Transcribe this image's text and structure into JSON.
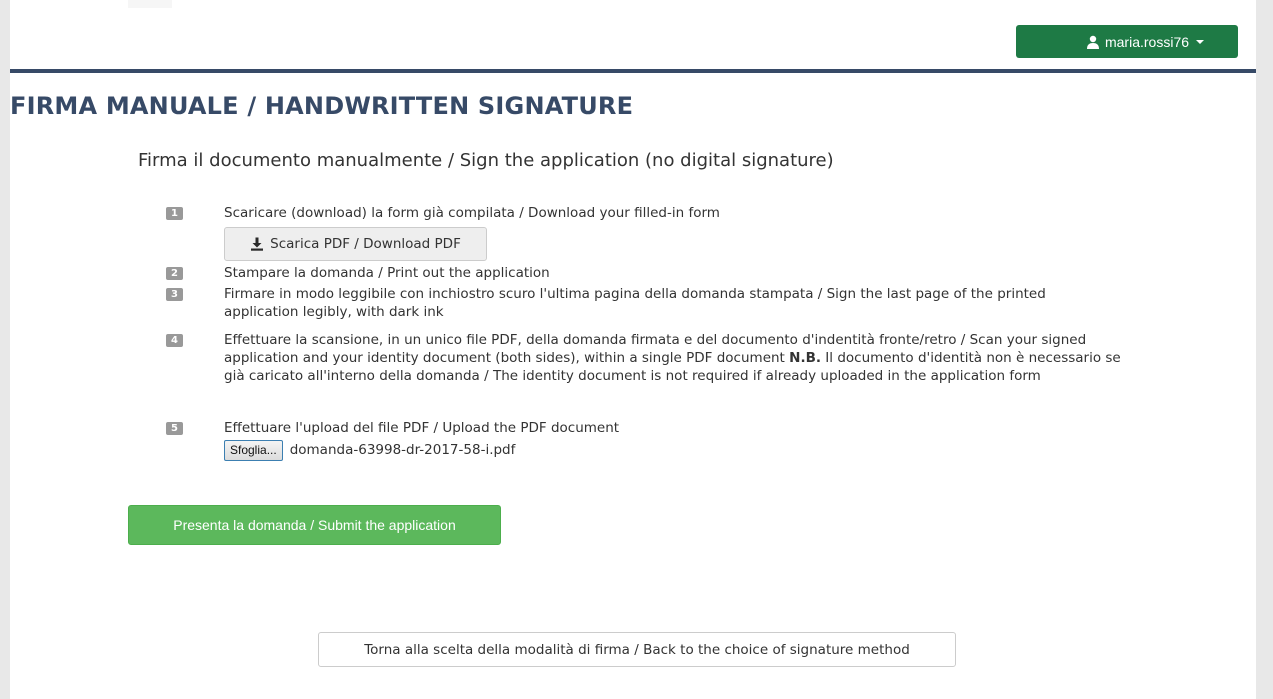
{
  "header": {
    "username": "maria.rossi76",
    "user_icon": "user-icon"
  },
  "page": {
    "title": "FIRMA MANUALE / HANDWRITTEN SIGNATURE",
    "subtitle": "Firma il documento manualmente / Sign the application (no digital signature)"
  },
  "steps": [
    {
      "num": "1",
      "text": "Scaricare (download) la form già compilata / Download your filled-in form"
    },
    {
      "num": "2",
      "text": "Stampare la domanda / Print out the application"
    },
    {
      "num": "3",
      "text": "Firmare in modo leggibile con inchiostro scuro l'ultima pagina della domanda stampata / Sign the last page of the printed application legibly, with dark ink"
    },
    {
      "num": "4",
      "text_before": "Effettuare la scansione, in un unico file PDF, della domanda firmata e del documento d'indentità fronte/retro / Scan your signed application and your identity document (both sides), within a single PDF document ",
      "note_label": "N.B.",
      "text_after": " Il documento d'identità non è necessario se già caricato all'interno della domanda / The identity document is not required if already uploaded in the application form"
    },
    {
      "num": "5",
      "text": "Effettuare l'upload del file PDF / Upload the PDF document"
    }
  ],
  "download": {
    "label": "Scarica PDF / Download PDF",
    "icon": "download-icon"
  },
  "upload": {
    "browse_label": "Sfoglia...",
    "file_name": "domanda-63998-dr-2017-58-i.pdf"
  },
  "actions": {
    "submit_label": "Presenta la domanda / Submit the application",
    "back_label": "Torna alla scelta della modalità di firma / Back to the choice of signature method"
  },
  "colors": {
    "header_button": "#1e7a45",
    "title": "#374a67",
    "submit": "#5cb85c",
    "badge": "#999999"
  }
}
